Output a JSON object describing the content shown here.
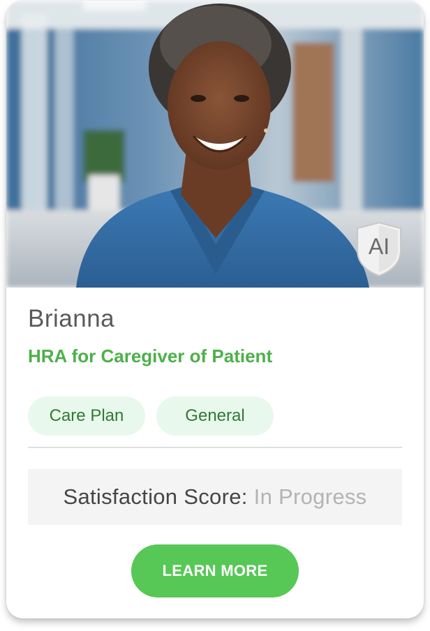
{
  "card": {
    "name": "Brianna",
    "subtitle": "HRA for Caregiver of Patient",
    "badge": {
      "label": "AI",
      "icon": "shield-icon"
    },
    "tags": [
      {
        "label": "Care Plan"
      },
      {
        "label": "General"
      }
    ],
    "satisfaction": {
      "label": "Satisfaction Score:",
      "value": "In Progress"
    },
    "cta_label": "LEARN MORE"
  },
  "colors": {
    "accent_green": "#4db04a",
    "button_green": "#57c856",
    "tag_background": "#e9f8ec",
    "tag_text": "#2f7a34",
    "score_background": "#f4f4f4",
    "muted_text": "#b3b3b3"
  }
}
